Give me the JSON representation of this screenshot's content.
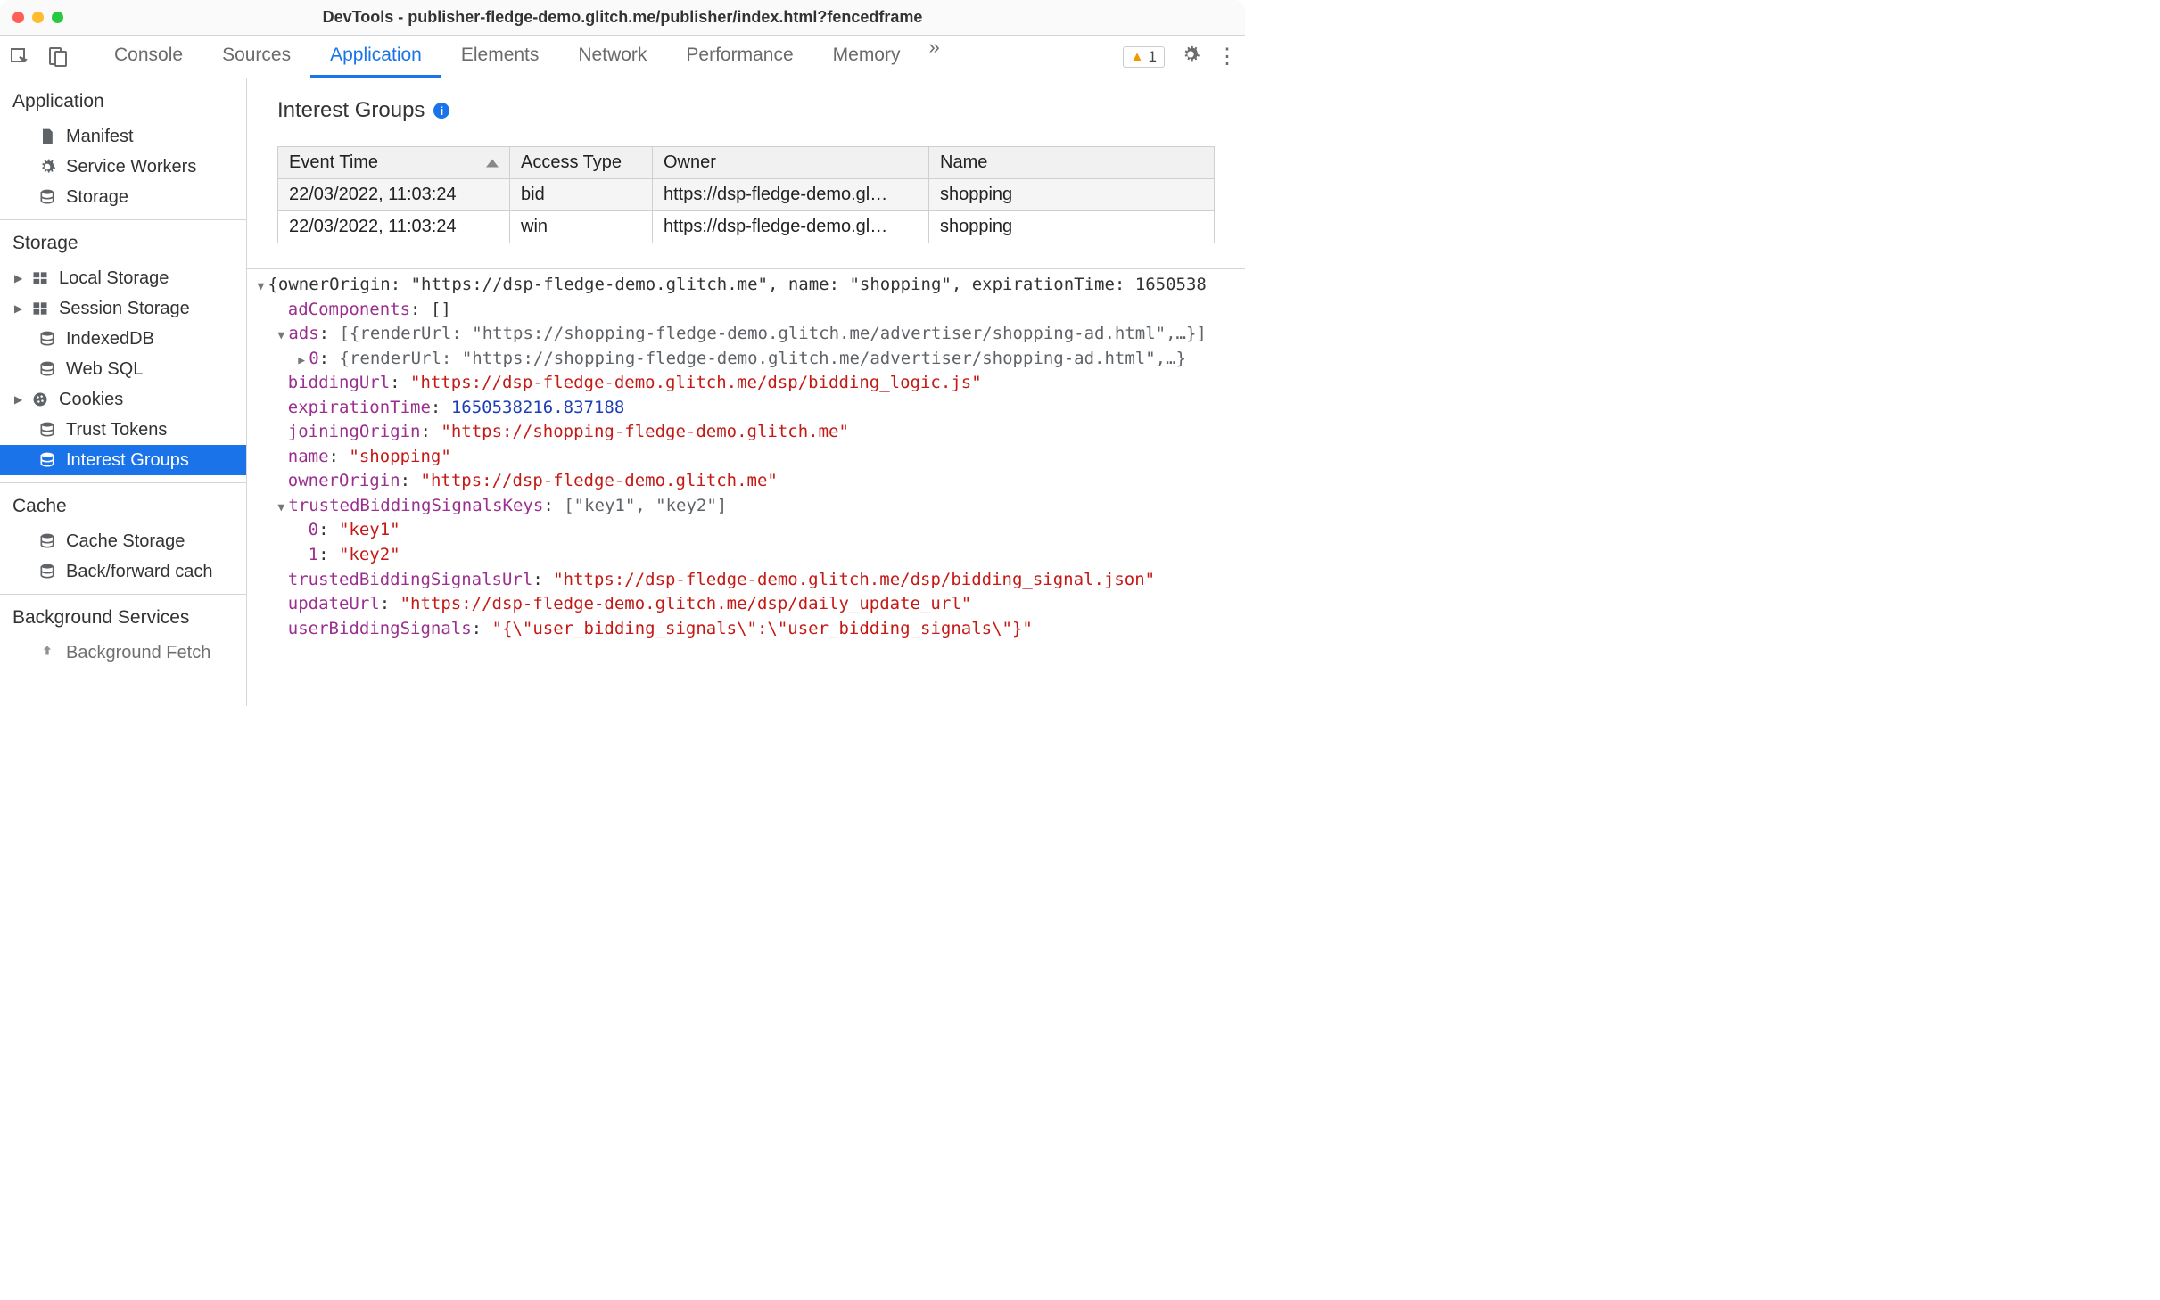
{
  "window_title": "DevTools - publisher-fledge-demo.glitch.me/publisher/index.html?fencedframe",
  "toolbar": {
    "tabs": [
      "Console",
      "Sources",
      "Application",
      "Elements",
      "Network",
      "Performance",
      "Memory"
    ],
    "active_tab": "Application",
    "more": "»",
    "warning_count": "1"
  },
  "sidebar": {
    "application": {
      "heading": "Application",
      "items": [
        {
          "label": "Manifest",
          "icon": "file"
        },
        {
          "label": "Service Workers",
          "icon": "gear"
        },
        {
          "label": "Storage",
          "icon": "db"
        }
      ]
    },
    "storage": {
      "heading": "Storage",
      "items": [
        {
          "label": "Local Storage",
          "icon": "grid",
          "disc": true
        },
        {
          "label": "Session Storage",
          "icon": "grid",
          "disc": true
        },
        {
          "label": "IndexedDB",
          "icon": "db"
        },
        {
          "label": "Web SQL",
          "icon": "db"
        },
        {
          "label": "Cookies",
          "icon": "cookie",
          "disc": true
        },
        {
          "label": "Trust Tokens",
          "icon": "db"
        },
        {
          "label": "Interest Groups",
          "icon": "db",
          "sel": true
        }
      ]
    },
    "cache": {
      "heading": "Cache",
      "items": [
        {
          "label": "Cache Storage",
          "icon": "db"
        },
        {
          "label": "Back/forward cach",
          "icon": "db"
        }
      ]
    },
    "bg": {
      "heading": "Background Services",
      "items": [
        {
          "label": "Background Fetch",
          "icon": "arrow"
        }
      ]
    }
  },
  "panel": {
    "title": "Interest Groups",
    "columns": [
      "Event Time",
      "Access Type",
      "Owner",
      "Name"
    ],
    "rows": [
      {
        "time": "22/03/2022, 11:03:24",
        "type": "bid",
        "owner": "https://dsp-fledge-demo.gl…",
        "name": "shopping"
      },
      {
        "time": "22/03/2022, 11:03:24",
        "type": "win",
        "owner": "https://dsp-fledge-demo.gl…",
        "name": "shopping"
      }
    ]
  },
  "inspector": {
    "top": "{ownerOrigin: \"https://dsp-fledge-demo.glitch.me\", name: \"shopping\", expirationTime: 1650538",
    "adComponents": {
      "key": "adComponents",
      "val": "[]"
    },
    "ads_summary": "[{renderUrl: \"https://shopping-fledge-demo.glitch.me/advertiser/shopping-ad.html\",…}]",
    "ads_0": "{renderUrl: \"https://shopping-fledge-demo.glitch.me/advertiser/shopping-ad.html\",…}",
    "biddingUrl": "\"https://dsp-fledge-demo.glitch.me/dsp/bidding_logic.js\"",
    "expirationTime": "1650538216.837188",
    "joiningOrigin": "\"https://shopping-fledge-demo.glitch.me\"",
    "name": "\"shopping\"",
    "ownerOrigin": "\"https://dsp-fledge-demo.glitch.me\"",
    "tbsk_summary": "[\"key1\", \"key2\"]",
    "tbsk_0": "\"key1\"",
    "tbsk_1": "\"key2\"",
    "trustedBiddingSignalsUrl": "\"https://dsp-fledge-demo.glitch.me/dsp/bidding_signal.json\"",
    "updateUrl": "\"https://dsp-fledge-demo.glitch.me/dsp/daily_update_url\"",
    "userBiddingSignals": "\"{\\\"user_bidding_signals\\\":\\\"user_bidding_signals\\\"}\""
  }
}
